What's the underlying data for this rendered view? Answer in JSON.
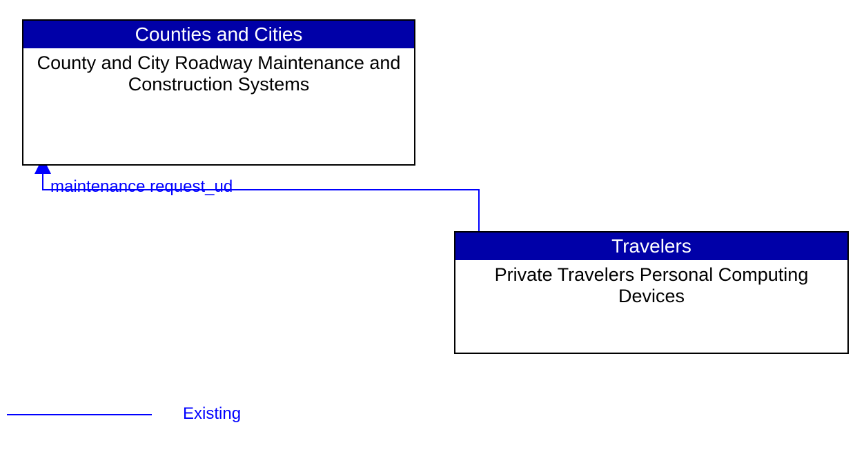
{
  "colors": {
    "header_bg": "#0000A8",
    "flow_line": "#0000ff",
    "flow_text": "#0000ff",
    "legend_text": "#0000ff"
  },
  "boxes": {
    "top_left": {
      "header": "Counties and Cities",
      "body": "County and City Roadway Maintenance and Construction Systems"
    },
    "bottom_right": {
      "header": "Travelers",
      "body": "Private Travelers Personal Computing Devices"
    }
  },
  "flows": {
    "mreq": {
      "label": "maintenance request_ud"
    }
  },
  "legend": {
    "existing": "Existing"
  }
}
